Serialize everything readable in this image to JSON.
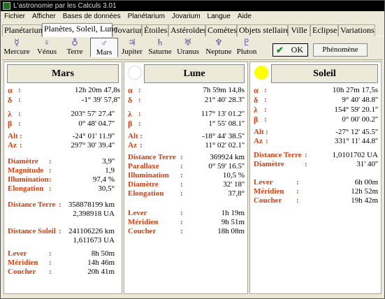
{
  "window": {
    "title": "L'astronomie par les Calculs 3.01"
  },
  "menu": [
    "Fichier",
    "Afficher",
    "Bases de données",
    "Planétarium",
    "Jovarium",
    "Langue",
    "Aide"
  ],
  "tabs": [
    "Planétarium",
    "Planètes, Soleil, Lune",
    "Jovarium",
    "Étoiles",
    "Astéroïdes",
    "Comètes",
    "Objets stellaires",
    "Ville",
    "Eclipse",
    "Variations"
  ],
  "active_tab": "Planètes, Soleil, Lune",
  "planets": [
    {
      "label": "Mercure",
      "symbol": "☿"
    },
    {
      "label": "Vénus",
      "symbol": "♀"
    },
    {
      "label": "Terre",
      "symbol": "♁"
    },
    {
      "label": "Mars",
      "symbol": "♂"
    },
    {
      "label": "Jupiter",
      "symbol": "♃"
    },
    {
      "label": "Saturne",
      "symbol": "♄"
    },
    {
      "label": "Uranus",
      "symbol": "♅"
    },
    {
      "label": "Neptune",
      "symbol": "♆"
    },
    {
      "label": "Pluton",
      "symbol": "♇"
    }
  ],
  "active_planet": "Mars",
  "buttons": {
    "ok": "OK",
    "phenomene": "Phénomène"
  },
  "colors": {
    "label": "#d04010",
    "sun": "#ffff00",
    "moon": "#ffffff",
    "window_bg": "#ece9d8",
    "titlebar": "#000000"
  },
  "mars": {
    "title": "Mars",
    "alpha": "12h 20m 47,8s",
    "delta": "-1° 39' 57,8''",
    "lambda": "203° 57' 27.4''",
    "beta": "0° 48' 04.7''",
    "alt": "-24° 01' 11.9''",
    "az": "297° 30' 39.4''",
    "diametre": "3,9''",
    "magnitude": "1,9",
    "illumination": "97,4 %",
    "elongation": "30,5°",
    "distance_terre_km": "358878199 km",
    "distance_terre_ua": "2,398918 UA",
    "distance_soleil_km": "241106226 km",
    "distance_soleil_ua": "1,611673 UA",
    "lever": "8h 50m",
    "meridien": "14h 46m",
    "coucher": "20h 41m"
  },
  "lune": {
    "title": "Lune",
    "alpha": "7h 59m 14,8s",
    "delta": "21° 40' 28.3''",
    "lambda": "117° 13' 01.2''",
    "beta": "1° 55' 08.1''",
    "alt": "-18° 44' 38.5''",
    "az": "11° 02' 02.1''",
    "distance_terre": "369924 km",
    "parallaxe": "0° 59' 16.5''",
    "illumination": "10,5 %",
    "diametre": "32' 18''",
    "elongation": "37,8°",
    "lever": "1h 19m",
    "meridien": "9h 51m",
    "coucher": "18h 08m"
  },
  "soleil": {
    "title": "Soleil",
    "alpha": "10h 27m 17,5s",
    "delta": "9° 40' 48.8''",
    "lambda": "154° 59' 20.1''",
    "beta": "0° 00' 00.2''",
    "alt": "-27° 12' 45.5''",
    "az": "331° 11' 44.8''",
    "distance_terre": "1,0101702 UA",
    "diametre": "31' 40''",
    "lever": "6h 00m",
    "meridien": "12h 52m",
    "coucher": "19h 42m"
  },
  "labels": {
    "alpha": "α",
    "delta": "δ",
    "lambda": "λ",
    "beta": "β",
    "alt": "Alt",
    "az": "Az",
    "diametre": "Diamètre",
    "magnitude": "Magnitude",
    "illumination": "Illumination",
    "elongation": "Elongation",
    "distance_terre": "Distance Terre",
    "distance_soleil": "Distance Soleil",
    "parallaxe": "Parallaxe",
    "lever": "Lever",
    "meridien": "Méridien",
    "coucher": "Coucher",
    "colon": ":"
  }
}
